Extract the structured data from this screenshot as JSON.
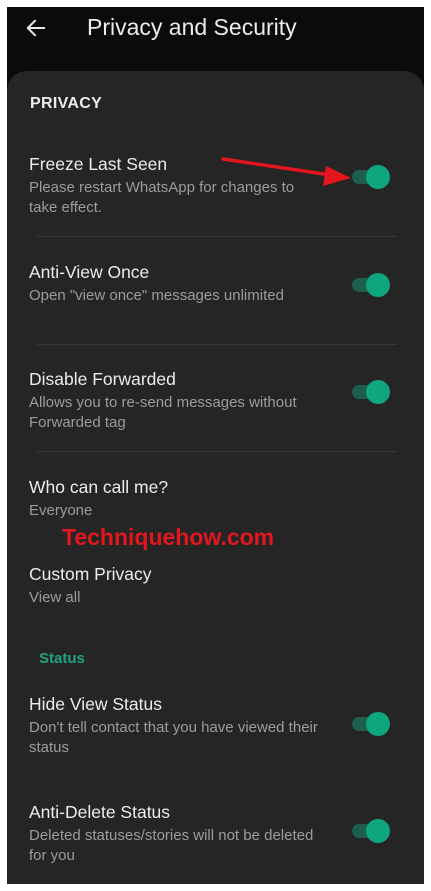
{
  "header": {
    "title": "Privacy and Security",
    "back_icon": "arrow-left-icon"
  },
  "sections": {
    "privacy": {
      "header": "PRIVACY"
    },
    "status": {
      "header": "Status"
    }
  },
  "items": {
    "freeze_last_seen": {
      "title": "Freeze Last Seen",
      "subtitle": "Please restart WhatsApp for changes to take effect.",
      "enabled": true
    },
    "anti_view_once": {
      "title": "Anti-View Once",
      "subtitle": "Open \"view once\" messages unlimited",
      "enabled": true
    },
    "disable_forwarded": {
      "title": "Disable Forwarded",
      "subtitle": "Allows you to re-send messages without Forwarded tag",
      "enabled": true
    },
    "who_can_call": {
      "title": "Who can call me?",
      "subtitle": "Everyone"
    },
    "custom_privacy": {
      "title": "Custom Privacy",
      "subtitle": "View all"
    },
    "hide_view_status": {
      "title": "Hide View Status",
      "subtitle": "Don't tell contact that you have viewed their status",
      "enabled": true
    },
    "anti_delete_status": {
      "title": "Anti-Delete Status",
      "subtitle": "Deleted statuses/stories will not be deleted for you",
      "enabled": true
    }
  },
  "watermark": {
    "text": "Techniquehow.com"
  },
  "colors": {
    "accent": "#0ea67e",
    "track": "#1d5e4d",
    "annotation_arrow": "#e3161e",
    "watermark": "#e3161e"
  }
}
